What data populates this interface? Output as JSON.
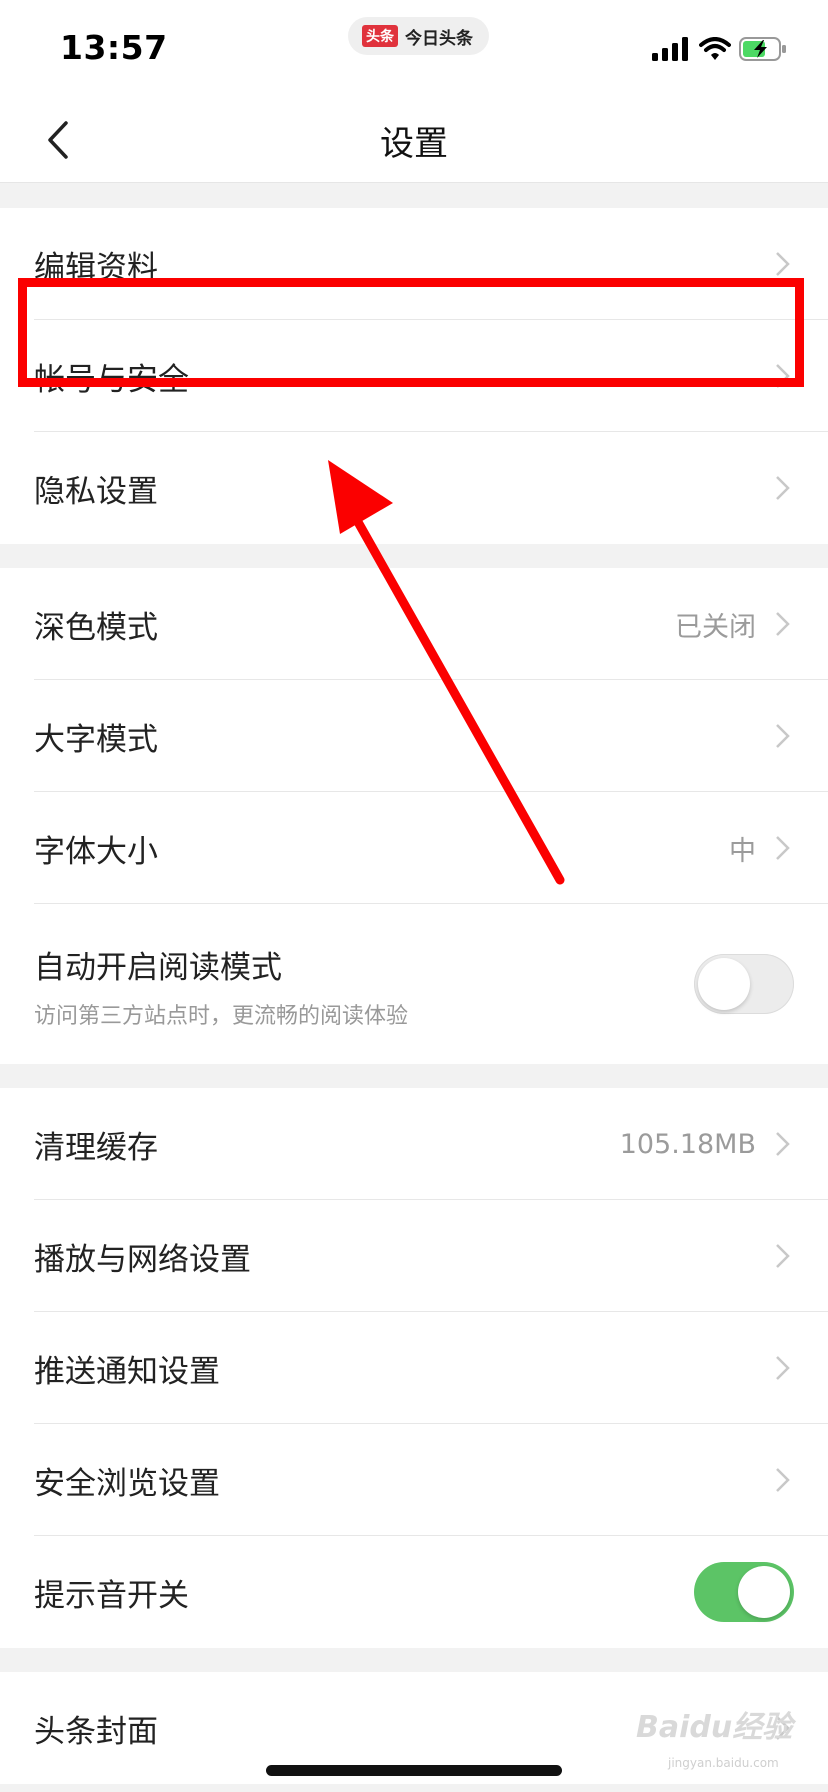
{
  "status_bar": {
    "time": "13:57",
    "app_badge": "头条",
    "app_name": "今日头条",
    "icons": [
      "signal-icon",
      "wifi-icon",
      "battery-charging-icon"
    ],
    "battery_color": "#4cd964"
  },
  "nav": {
    "back_icon": "chevron-left-icon",
    "title": "设置"
  },
  "sections": [
    {
      "items": [
        {
          "label": "编辑资料",
          "value": ""
        },
        {
          "label": "帐号与安全",
          "value": "",
          "highlighted": true
        },
        {
          "label": "隐私设置",
          "value": ""
        }
      ]
    },
    {
      "items": [
        {
          "label": "深色模式",
          "value": "已关闭"
        },
        {
          "label": "大字模式",
          "value": ""
        },
        {
          "label": "字体大小",
          "value": "中"
        },
        {
          "label": "自动开启阅读模式",
          "sublabel": "访问第三方站点时，更流畅的阅读体验",
          "toggle": false
        }
      ]
    },
    {
      "items": [
        {
          "label": "清理缓存",
          "value": "105.18MB"
        },
        {
          "label": "播放与网络设置",
          "value": ""
        },
        {
          "label": "推送通知设置",
          "value": ""
        },
        {
          "label": "安全浏览设置",
          "value": ""
        },
        {
          "label": "提示音开关",
          "toggle": true
        }
      ]
    },
    {
      "items": [
        {
          "label": "头条封面",
          "value": ""
        }
      ]
    }
  ],
  "colors": {
    "annotation": "#fb0000",
    "toggle_on": "#5cc466",
    "toggle_off": "#ececec",
    "background": "#f2f2f2"
  },
  "watermark": {
    "text": "Baidu经验",
    "url": "jingyan.baidu.com"
  }
}
